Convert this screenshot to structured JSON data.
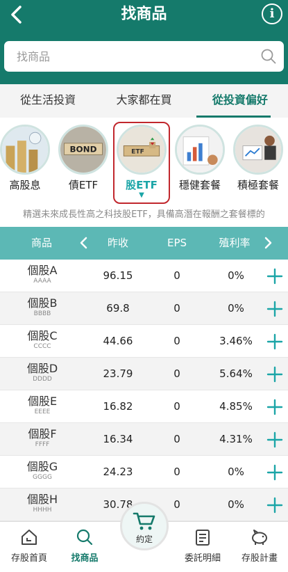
{
  "header": {
    "title": "找商品",
    "back_icon": "chevron-left-icon",
    "info_icon": "info-icon",
    "info_symbol": "i"
  },
  "search": {
    "placeholder": "找商品",
    "value": ""
  },
  "tabs": [
    {
      "label": "從生活投資",
      "active": false
    },
    {
      "label": "大家都在買",
      "active": false
    },
    {
      "label": "從投資偏好",
      "active": true
    }
  ],
  "categories": [
    {
      "label": "高股息",
      "icon": "coin-stack-icon",
      "active": false
    },
    {
      "label": "債ETF",
      "icon": "bond-blocks-icon",
      "active": false
    },
    {
      "label": "股ETF",
      "icon": "etf-blocks-icon",
      "active": true,
      "caret": "▼"
    },
    {
      "label": "穩健套餐",
      "icon": "report-chart-icon",
      "active": false
    },
    {
      "label": "積極套餐",
      "icon": "meeting-icon",
      "active": false
    }
  ],
  "description": "精選未來成長性高之科技股ETF，具備高潛在報酬之套餐標的",
  "table": {
    "headers": {
      "name": "商品",
      "close": "昨收",
      "eps": "EPS",
      "yield": "殖利率"
    },
    "rows": [
      {
        "name": "個股A",
        "code": "AAAA",
        "close": "96.15",
        "eps": "0",
        "yield": "0%"
      },
      {
        "name": "個股B",
        "code": "BBBB",
        "close": "69.8",
        "eps": "0",
        "yield": "0%"
      },
      {
        "name": "個股C",
        "code": "CCCC",
        "close": "44.66",
        "eps": "0",
        "yield": "3.46%"
      },
      {
        "name": "個股D",
        "code": "DDDD",
        "close": "23.79",
        "eps": "0",
        "yield": "5.64%"
      },
      {
        "name": "個股E",
        "code": "EEEE",
        "close": "16.82",
        "eps": "0",
        "yield": "4.85%"
      },
      {
        "name": "個股F",
        "code": "FFFF",
        "close": "16.34",
        "eps": "0",
        "yield": "4.31%"
      },
      {
        "name": "個股G",
        "code": "GGGG",
        "close": "24.23",
        "eps": "0",
        "yield": "0%"
      },
      {
        "name": "個股H",
        "code": "HHHH",
        "close": "30.78",
        "eps": "0",
        "yield": "0%"
      }
    ]
  },
  "nav": {
    "home": "存股首頁",
    "find": "找商品",
    "appointment": "約定",
    "orders": "委託明細",
    "plan": "存股計畫"
  },
  "colors": {
    "primary": "#157a6b",
    "header_table": "#5cb8b5",
    "accent": "#1ba5a7",
    "highlight_frame": "#c1272d"
  }
}
